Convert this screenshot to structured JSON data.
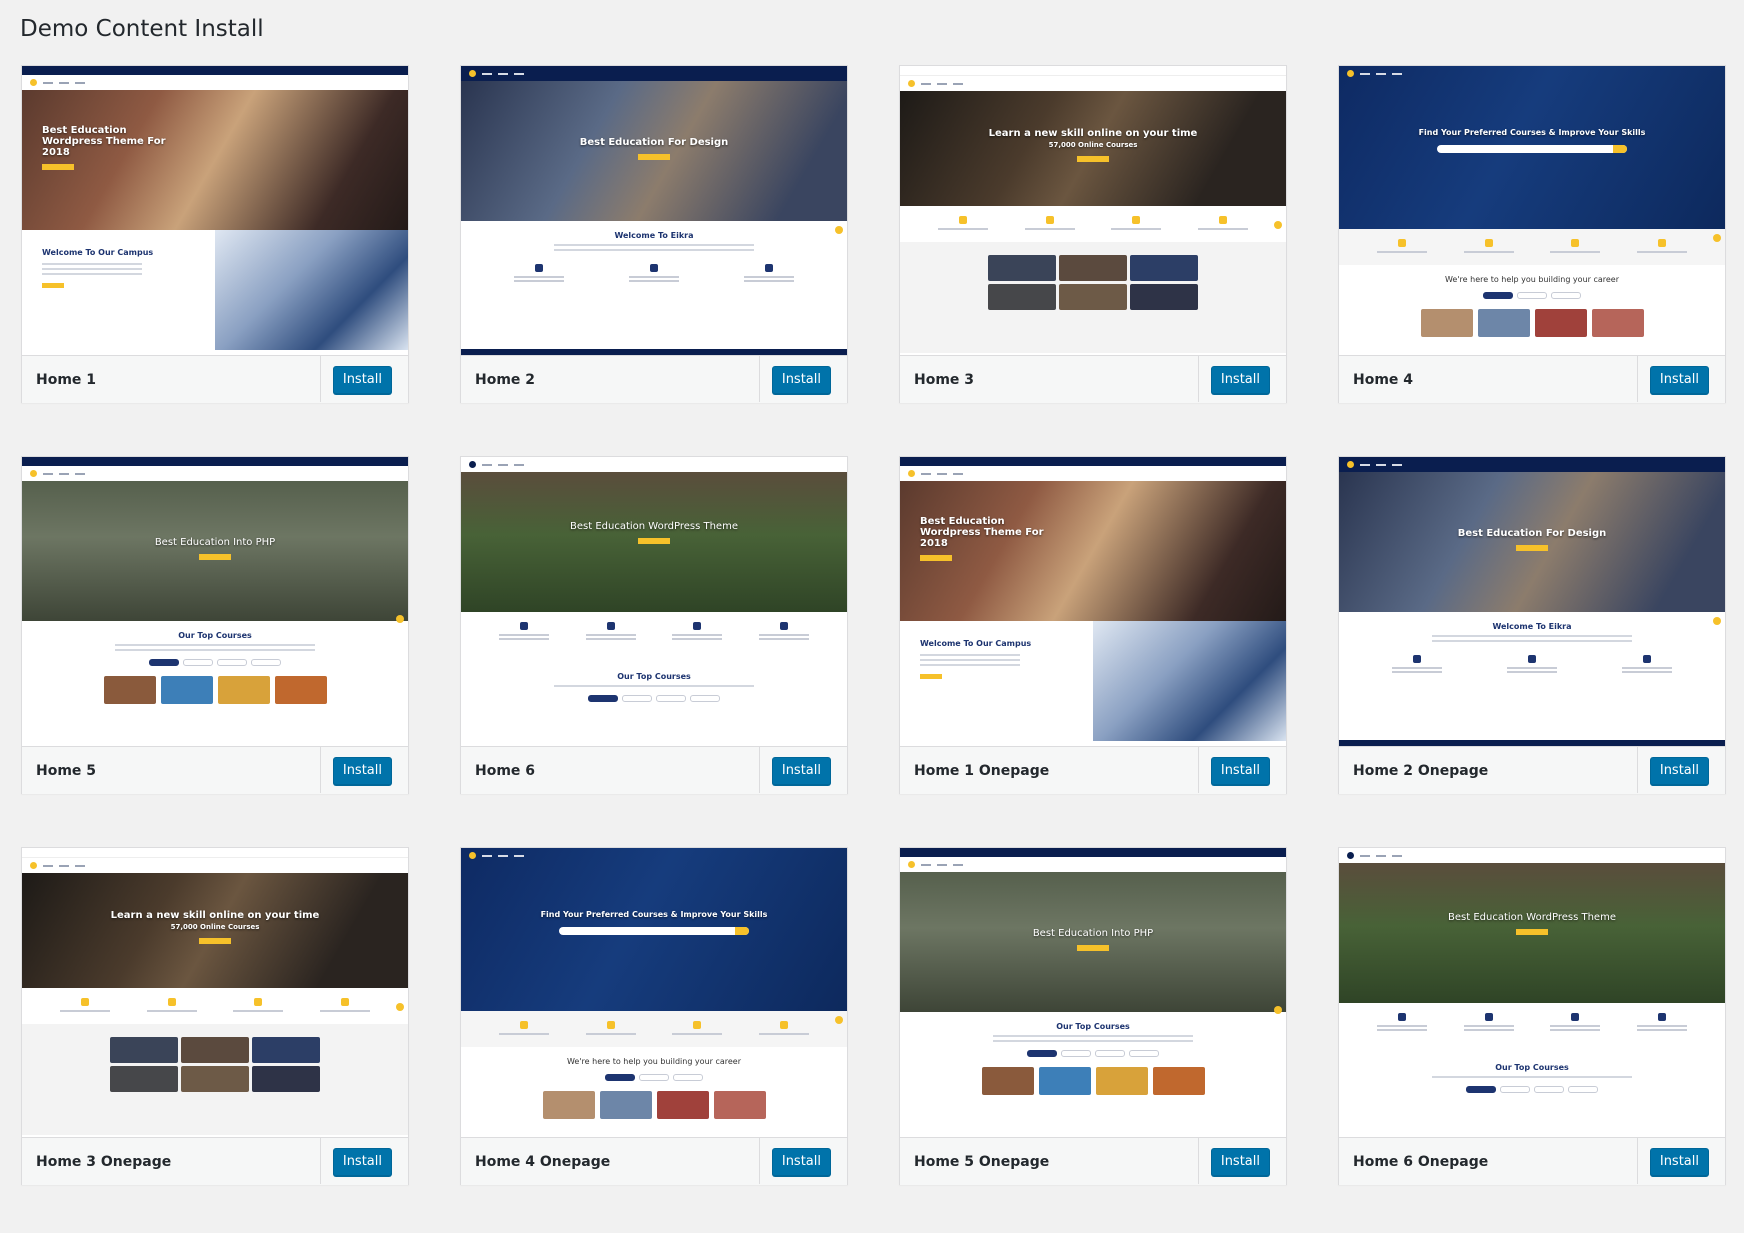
{
  "page": {
    "title": "Demo Content Install"
  },
  "colors": {
    "install_button": "#0073aa",
    "accent": "#f6c12a",
    "navy": "#0a1e4f",
    "background": "#f1f1f1"
  },
  "cards": [
    {
      "name": "Home 1",
      "button": "Install",
      "hero_title": "Best Education Wordpress Theme For 2018",
      "section_title": "Welcome To Our Campus"
    },
    {
      "name": "Home 2",
      "button": "Install",
      "hero_title": "Best Education For Design",
      "section_title": "Welcome To Eikra"
    },
    {
      "name": "Home 3",
      "button": "Install",
      "hero_title": "Learn a new skill online on your time",
      "hero_subtitle": "57,000 Online Courses"
    },
    {
      "name": "Home 4",
      "button": "Install",
      "hero_title": "Find Your Preferred Courses & Improve Your Skills",
      "section_title": "We're here to help you building your career"
    },
    {
      "name": "Home 5",
      "button": "Install",
      "hero_title": "Best Education Into PHP",
      "section_title": "Our Top Courses"
    },
    {
      "name": "Home 6",
      "button": "Install",
      "hero_title": "Best Education WordPress Theme",
      "section_title": "Our Top Courses"
    },
    {
      "name": "Home 1 Onepage",
      "button": "Install",
      "hero_title": "Best Education Wordpress Theme For 2018",
      "section_title": "Welcome To Our Campus"
    },
    {
      "name": "Home 2 Onepage",
      "button": "Install",
      "hero_title": "Best Education For Design",
      "section_title": "Welcome To Eikra"
    },
    {
      "name": "Home 3 Onepage",
      "button": "Install",
      "hero_title": "Learn a new skill online on your time",
      "hero_subtitle": "57,000 Online Courses"
    },
    {
      "name": "Home 4 Onepage",
      "button": "Install",
      "hero_title": "Find Your Preferred Courses & Improve Your Skills",
      "section_title": "We're here to help you building your career"
    },
    {
      "name": "Home 5 Onepage",
      "button": "Install",
      "hero_title": "Best Education Into PHP",
      "section_title": "Our Top Courses"
    },
    {
      "name": "Home 6 Onepage",
      "button": "Install",
      "hero_title": "Best Education WordPress Theme",
      "section_title": "Our Top Courses"
    }
  ]
}
